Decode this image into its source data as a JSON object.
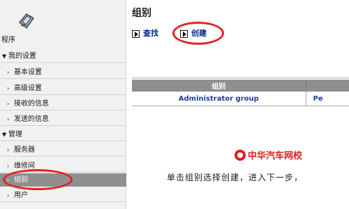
{
  "sidebar": {
    "top_label": "程序",
    "section_my_settings": "我的设置",
    "item_basic": "基本设置",
    "item_advanced": "高级设置",
    "item_received": "接收的信息",
    "item_sent": "发送的信息",
    "section_manage": "管理",
    "item_servers": "服务器",
    "item_rooms": "维修间",
    "item_groups": "组别",
    "item_users": "用户"
  },
  "main": {
    "title": "组别",
    "toolbar": {
      "find_label": "查找",
      "create_label": "创建"
    }
  },
  "table": {
    "header": "组别",
    "row1_col1": "Administrator group",
    "row1_col2": "Pe"
  },
  "watermark": {
    "text": "中华汽车网校"
  },
  "caption": "单击组别选择创建，进入下一步，",
  "colors": {
    "highlight": "#e32323",
    "selected_row": "#8f8f8f",
    "link": "#0a2a8a",
    "table_header": "#8f8f8f"
  }
}
